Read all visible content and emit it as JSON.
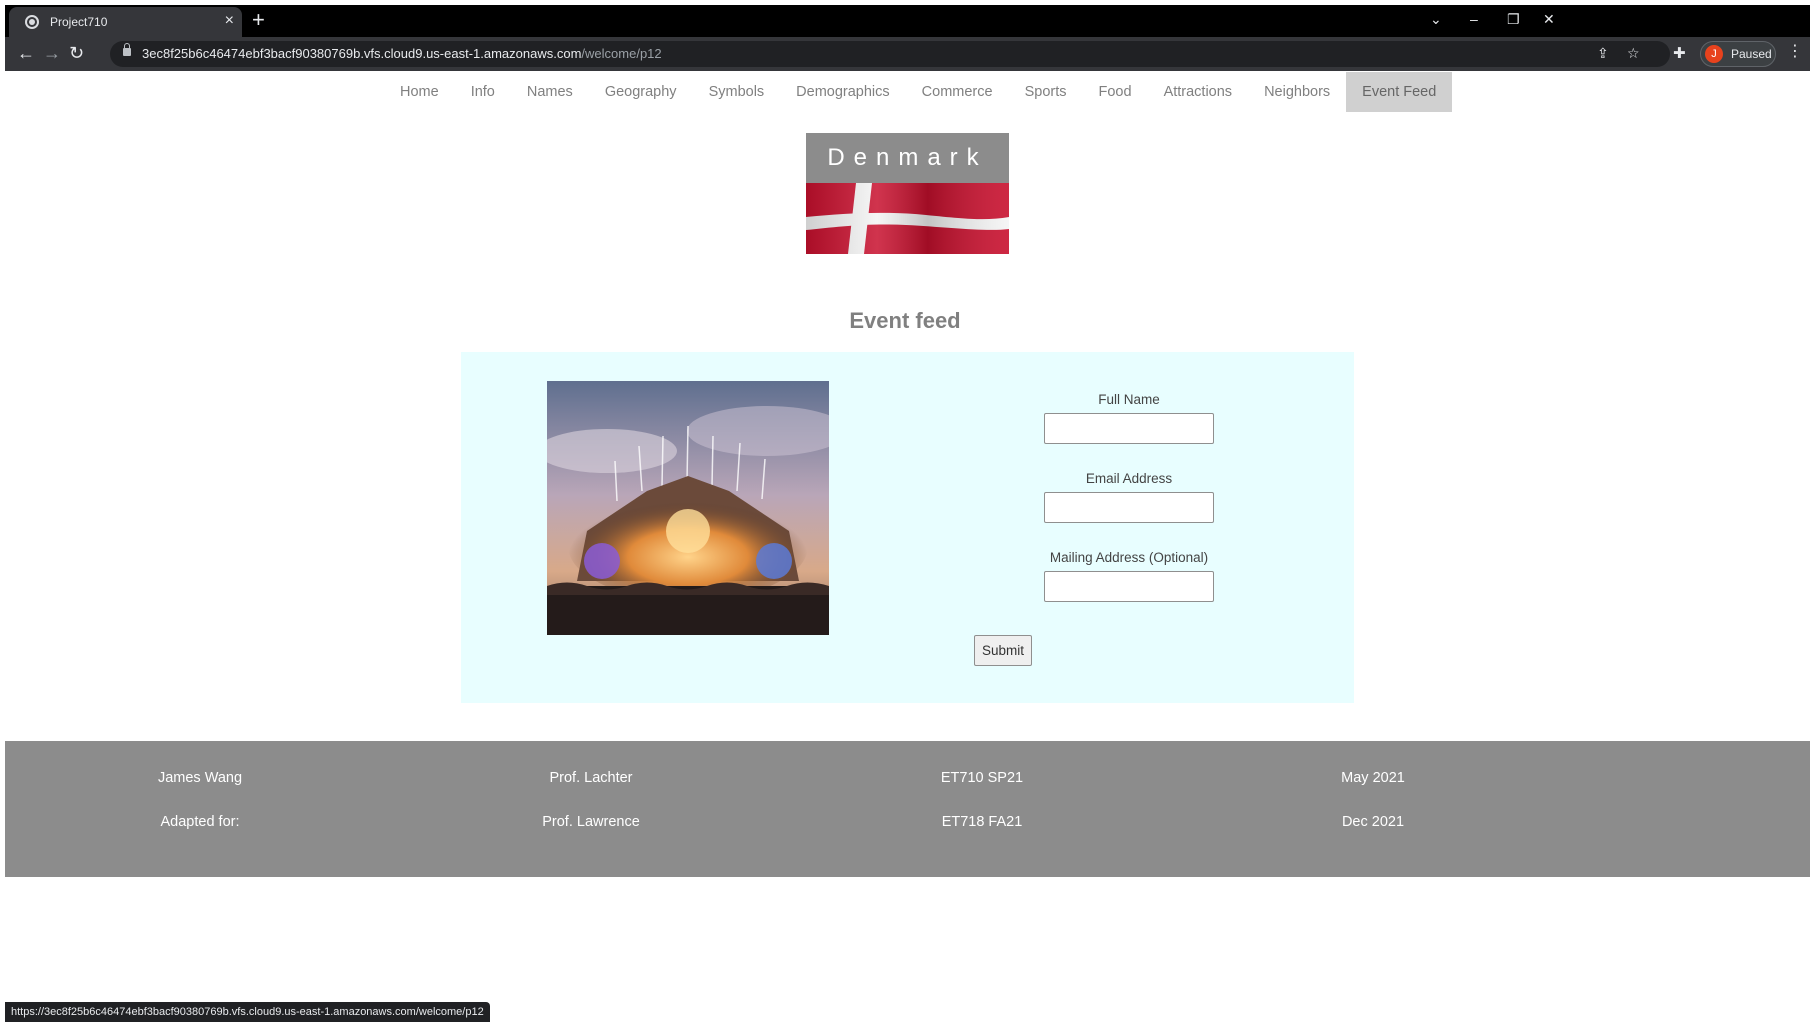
{
  "browser": {
    "tab_title": "Project710",
    "tab_close": "×",
    "new_tab": "+",
    "url_host": "3ec8f25b6c46474ebf3bacf90380769b.vfs.cloud9.us-east-1.amazonaws.com",
    "url_path": "/welcome/p12",
    "profile_initial": "J",
    "profile_status": "Paused",
    "status_url": "https://3ec8f25b6c46474ebf3bacf90380769b.vfs.cloud9.us-east-1.amazonaws.com/welcome/p12",
    "icons": {
      "back": "←",
      "forward": "→",
      "reload": "↻",
      "share": "⇪",
      "star": "☆",
      "extensions": "✚",
      "menu": "⋮",
      "tab_search": "⌄",
      "minimize": "–",
      "restore": "❐",
      "close": "✕"
    }
  },
  "nav": {
    "items": [
      "Home",
      "Info",
      "Names",
      "Geography",
      "Symbols",
      "Demographics",
      "Commerce",
      "Sports",
      "Food",
      "Attractions",
      "Neighbors",
      "Event Feed"
    ],
    "active": "Event Feed"
  },
  "banner": {
    "title": "Denmark",
    "colors": {
      "flag_red": "#c8102e",
      "flag_white": "#ffffff",
      "bar": "#8c8c8c"
    }
  },
  "section": {
    "title": "Event feed"
  },
  "form": {
    "full_name_label": "Full Name",
    "email_label": "Email Address",
    "mailing_label": "Mailing Address (Optional)",
    "full_name_value": "",
    "email_value": "",
    "mailing_value": "",
    "submit_label": "Submit"
  },
  "footer": {
    "row1": [
      "James Wang",
      "Prof. Lachter",
      "ET710 SP21",
      "May 2021"
    ],
    "row2": [
      "Adapted for:",
      "Prof. Lawrence",
      "ET718 FA21",
      "Dec 2021"
    ]
  },
  "colors": {
    "panel_bg": "#e8feff",
    "footer_bg": "#8c8c8c",
    "nav_active_bg": "#d0d0d0"
  }
}
